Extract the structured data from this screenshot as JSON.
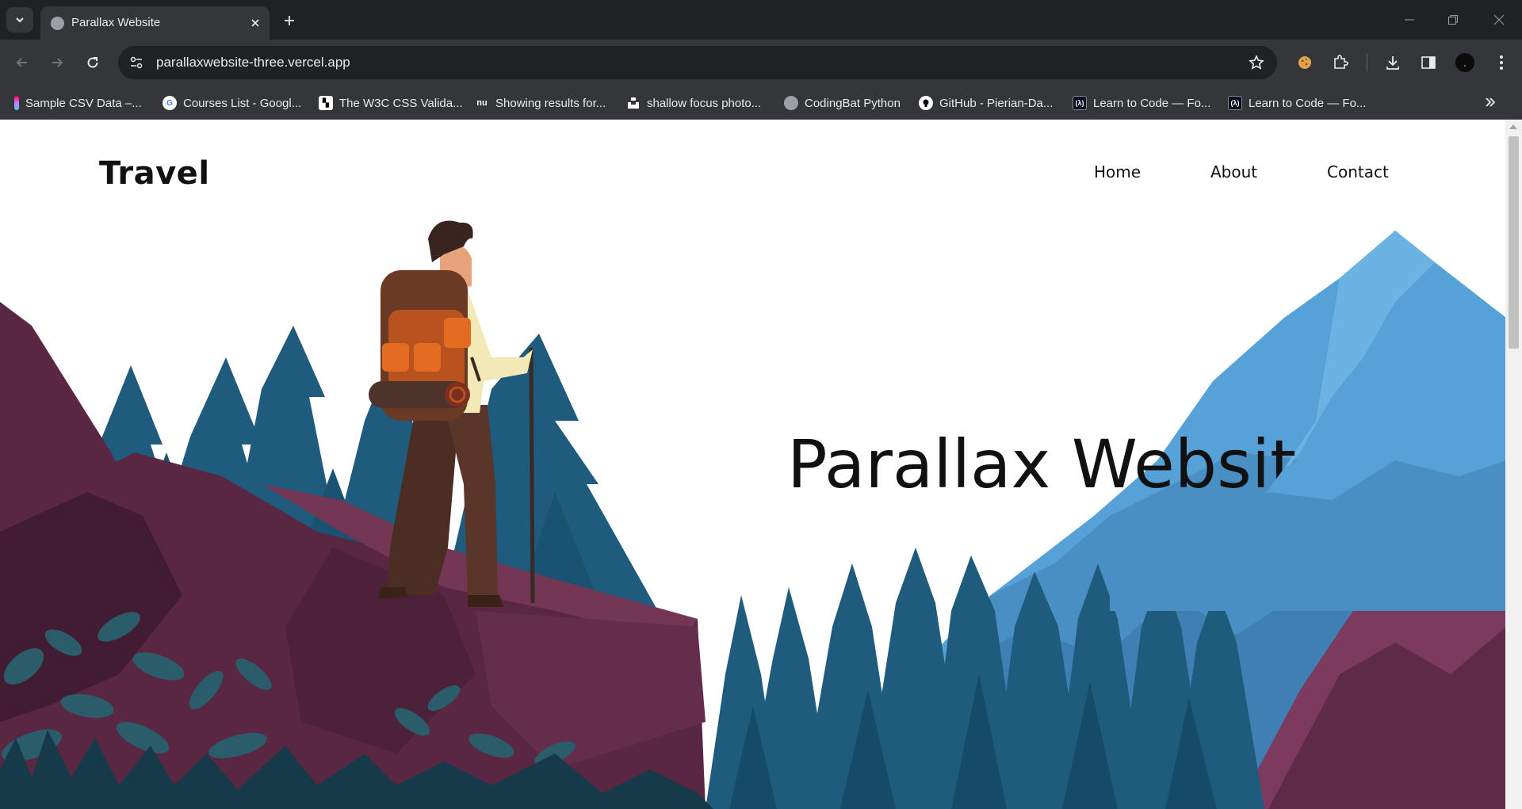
{
  "browser": {
    "tab_title": "Parallax Website",
    "url": "parallaxwebsite-three.vercel.app",
    "bookmarks": [
      {
        "label": "Sample CSV Data –...",
        "icon": "csv-icon",
        "color": "#c77dff"
      },
      {
        "label": "Courses List - Googl...",
        "icon": "google-icon",
        "color": "#ffffff"
      },
      {
        "label": "The W3C CSS Valida...",
        "icon": "w3c-icon",
        "color": "#ffffff"
      },
      {
        "label": "Showing results for...",
        "icon": "nu-icon",
        "color": "#35363a"
      },
      {
        "label": "shallow focus photo...",
        "icon": "unsplash-icon",
        "color": "#ffffff"
      },
      {
        "label": "CodingBat Python",
        "icon": "globe-icon",
        "color": "#9aa0a6"
      },
      {
        "label": "GitHub - Pierian-Da...",
        "icon": "github-icon",
        "color": "#ffffff"
      },
      {
        "label": "Learn to Code — Fo...",
        "icon": "freecodecamp-icon",
        "color": "#0a0a23"
      },
      {
        "label": "Learn to Code — Fo...",
        "icon": "freecodecamp-icon",
        "color": "#0a0a23"
      }
    ]
  },
  "page": {
    "logo": "Travel",
    "nav": {
      "home": "Home",
      "about": "About",
      "contact": "Contact"
    },
    "hero_title": "Parallax Website"
  },
  "colors": {
    "sky": "#ffffff",
    "mountain_blue": "#56a2d8",
    "mountain_blue_dark": "#3f7fb3",
    "pine": "#1e5b7d",
    "pine_dark": "#164a69",
    "rock": "#5a2743",
    "rock_light": "#733654",
    "rock_dark": "#421c33",
    "foliage": "#2b5c6a"
  }
}
